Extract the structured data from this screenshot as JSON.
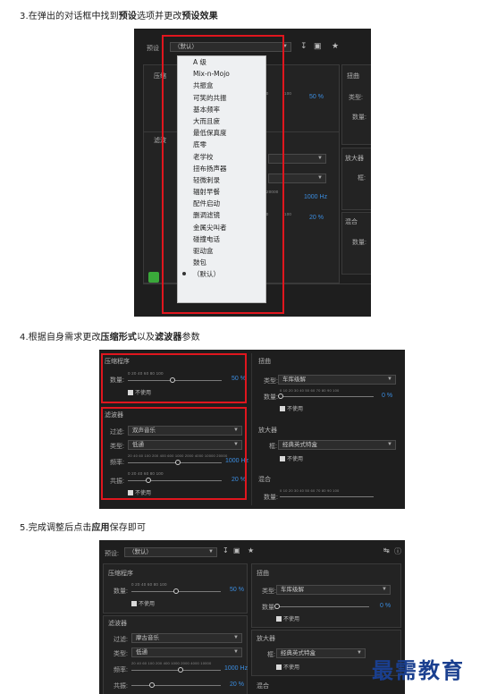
{
  "steps": {
    "step3_prefix": "3.在弹出的对话框中找到",
    "step3_bold1": "预设",
    "step3_mid": "选项并更改",
    "step3_bold2": "预设效果",
    "step4_prefix": "4.根据自身需求更改",
    "step4_bold1": "压缩形式",
    "step4_mid": "以及",
    "step4_bold2": "滤波器",
    "step4_suffix": "参数",
    "step5_prefix": "5.完成调整后点击",
    "step5_bold": "应用",
    "step5_suffix": "保存即可"
  },
  "shot1": {
    "preset_label": "预设",
    "preset_value": "（默认）",
    "left_label_1": "压缩",
    "left_label_2": "滤波",
    "right_title": "扭曲",
    "right_type": "类型:",
    "right_amount": "数量:",
    "amp_title": "放大器",
    "amp_sub": "框:",
    "mix_title": "混合",
    "mix_amount": "数量:",
    "val_50": "50 %",
    "val_1000": "1000 Hz",
    "val_20": "20 %",
    "tick_80": "80",
    "tick_100": "100",
    "tick_20000": "20000",
    "menu_items": [
      "A 级",
      "Mix-n-Mojo",
      "共振盒",
      "可笑的共振",
      "基本频率",
      "大而且疲",
      "最低保真度",
      "底零",
      "老学校",
      "扭布扬声器",
      "轻微刺录",
      "辐射早餐",
      "配件启动",
      "删调滤镜",
      "金属尖叫者",
      "碰撞电话",
      "驱动盒",
      "鼓包",
      "（默认）"
    ]
  },
  "shot2": {
    "compress_title": "压缩程序",
    "amount_label": "数量:",
    "compress_ticks": "0   20   40   60   80   100",
    "compress_val": "50 %",
    "bypass": "不使用",
    "filter_title": "滤波器",
    "filter_label": "过滤:",
    "filter_value": "双声音乐",
    "type_label": "类型:",
    "type_value": "低通",
    "freq_label": "频率:",
    "freq_ticks": "20  40  60  100  200  400  600 1000  2000  4000 10000 20000",
    "freq_val": "1000 Hz",
    "res_label": "共振:",
    "res_ticks": "0   20   40   60   80   100",
    "res_val": "20 %",
    "distort_title": "扭曲",
    "distort_type_label": "类型:",
    "distort_type_value": "车库级解",
    "distort_amount_label": "数量:",
    "distort_ticks": "0  10  20  30  40  50  60  70  80  90  100",
    "distort_val": "0 %",
    "amp_title": "放大器",
    "amp_label": "框:",
    "amp_value": "经典英式特盒",
    "mix_title": "混合",
    "mix_label": "数量:",
    "mix_ticks": "0  10  20  30  40  50  60  70  80  90  100"
  },
  "shot3": {
    "preset_label": "预设:",
    "preset_value": "（默认）",
    "compress_title": "压缩程序",
    "amount_label": "数量:",
    "compress_ticks": "0   20   40   60   80   100",
    "compress_val": "50 %",
    "bypass": "不使用",
    "filter_title": "滤波器",
    "filter_label": "过滤:",
    "filter_value": "摩古音乐",
    "type_label": "类型:",
    "type_value": "低通",
    "freq_label": "频率:",
    "freq_ticks": "20  40  60  100  200  400 1000 2000 4000 10000",
    "freq_val": "1000 Hz",
    "res_label": "共振:",
    "res_val": "20 %",
    "distort_title": "扭曲",
    "distort_type_label": "类型:",
    "distort_type_value": "车库级解",
    "distort_amount_label": "数量:",
    "distort_val": "0 %",
    "amp_title": "放大器",
    "amp_label": "框:",
    "amp_value": "经典英式特盒",
    "mix_title": "混合"
  },
  "watermark": "最需教育"
}
